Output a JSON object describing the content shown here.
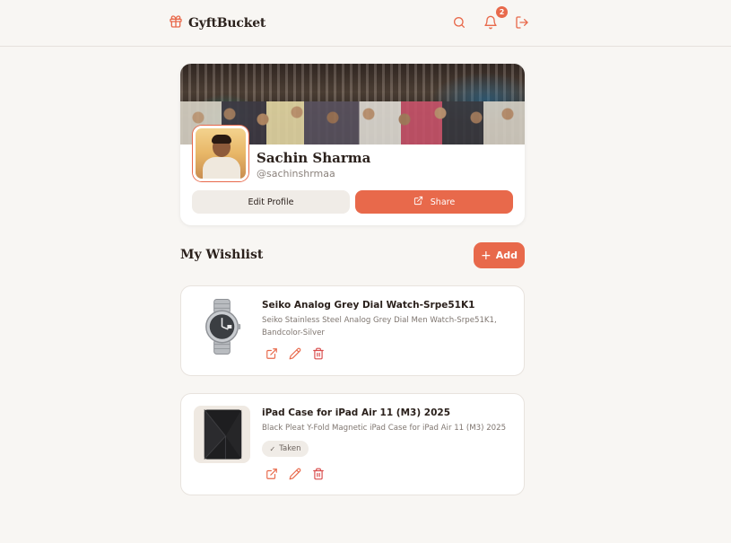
{
  "app": {
    "name": "GyftBucket",
    "notification_count": "2"
  },
  "colors": {
    "accent": "#e8694b",
    "background": "#f8f6f3",
    "delete": "#d94b4b"
  },
  "profile": {
    "name": "Sachin Sharma",
    "username": "@sachinshrmaa",
    "edit_label": "Edit Profile",
    "share_label": "Share"
  },
  "wishlist": {
    "title": "My Wishlist",
    "add_label": "Add",
    "items": [
      {
        "title": "Seiko Analog Grey Dial Watch-Srpe51K1",
        "description": "Seiko Stainless Steel Analog Grey Dial Men Watch-Srpe51K1, Bandcolor-Silver",
        "image_icon": "watch-image"
      },
      {
        "title": "iPad Case for iPad Air 11 (M3) 2025",
        "description": "Black Pleat Y-Fold Magnetic iPad Case for iPad Air 11 (M3) 2025",
        "status": "Taken",
        "image_icon": "ipad-case-image"
      }
    ]
  }
}
